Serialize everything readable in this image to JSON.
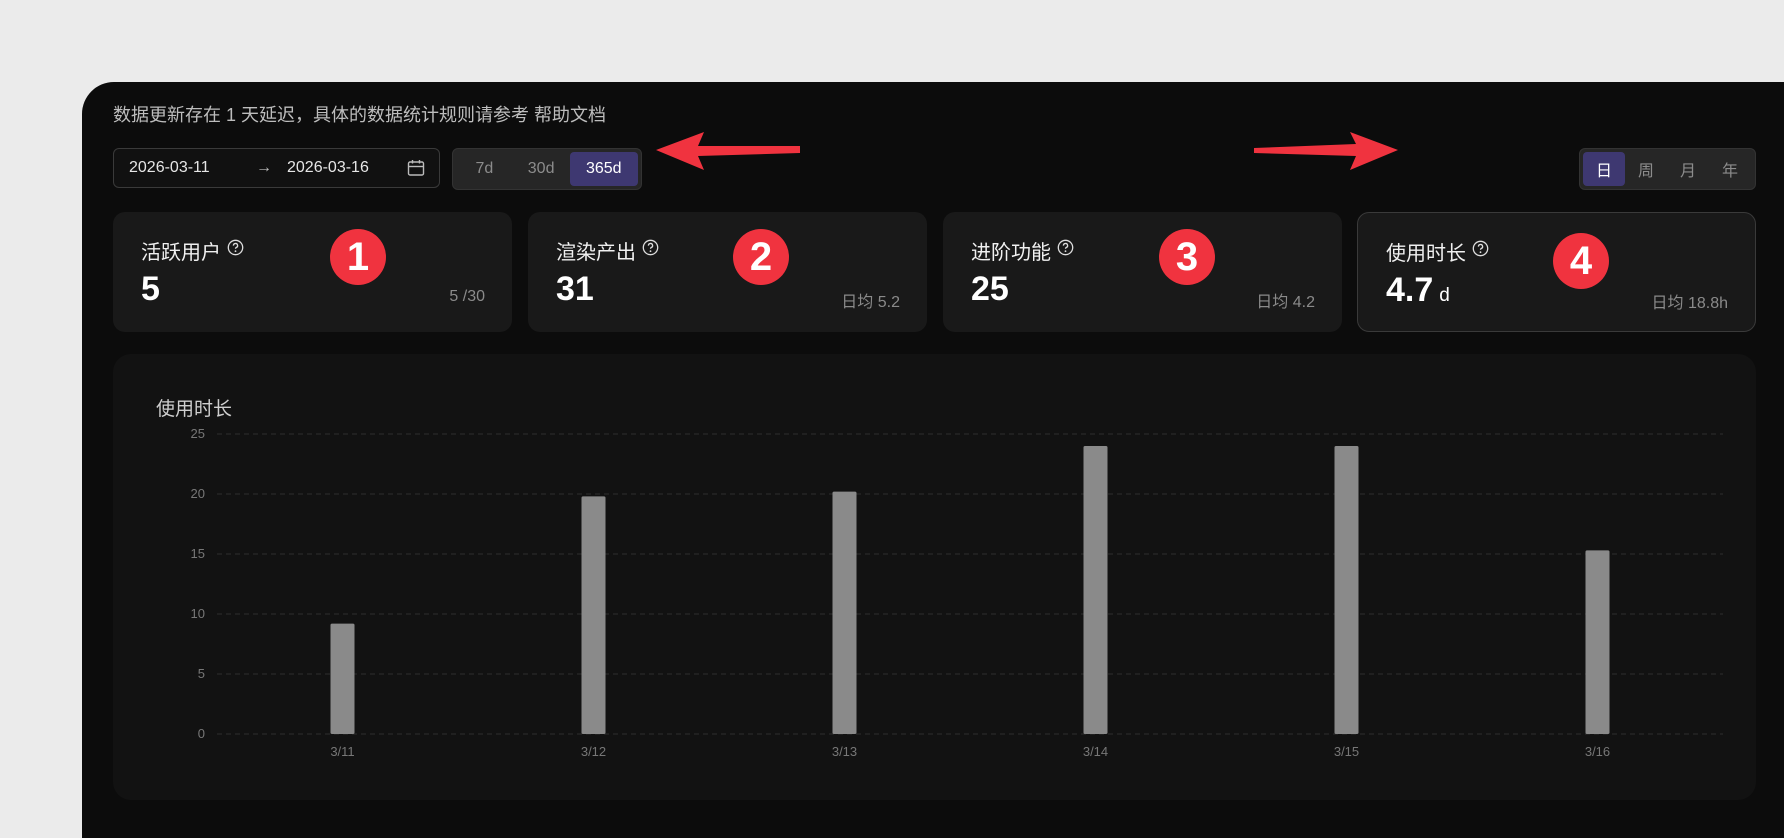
{
  "notice": "数据更新存在 1 天延迟，具体的数据统计规则请参考 帮助文档",
  "date_range": {
    "start": "2026-03-11",
    "separator": "→",
    "end": "2026-03-16"
  },
  "range_options": [
    {
      "label": "7d",
      "active": false
    },
    {
      "label": "30d",
      "active": false
    },
    {
      "label": "365d",
      "active": true
    }
  ],
  "granularity_options": [
    {
      "label": "日",
      "active": true
    },
    {
      "label": "周",
      "active": false
    },
    {
      "label": "月",
      "active": false
    },
    {
      "label": "年",
      "active": false
    }
  ],
  "cards": [
    {
      "label": "活跃用户",
      "value": "5",
      "unit": "",
      "sub": "5 /30",
      "badge": "1"
    },
    {
      "label": "渲染产出",
      "value": "31",
      "unit": "",
      "sub": "日均 5.2",
      "badge": "2"
    },
    {
      "label": "进阶功能",
      "value": "25",
      "unit": "",
      "sub": "日均 4.2",
      "badge": "3"
    },
    {
      "label": "使用时长",
      "value": "4.7",
      "unit": "d",
      "sub": "日均 18.8h",
      "badge": "4"
    }
  ],
  "colors": {
    "accent": "#3e3871",
    "badge": "#f0333f",
    "bar": "#8a8a8a",
    "annotation_arrow": "#f0333f"
  },
  "chart_data": {
    "type": "bar",
    "title": "使用时长",
    "categories": [
      "3/11",
      "3/12",
      "3/13",
      "3/14",
      "3/15",
      "3/16"
    ],
    "values": [
      9.2,
      19.8,
      20.2,
      24.0,
      24.0,
      15.3
    ],
    "yticks": [
      0,
      5,
      10,
      15,
      20,
      25
    ],
    "ylim": [
      0,
      25
    ],
    "grid": true
  }
}
